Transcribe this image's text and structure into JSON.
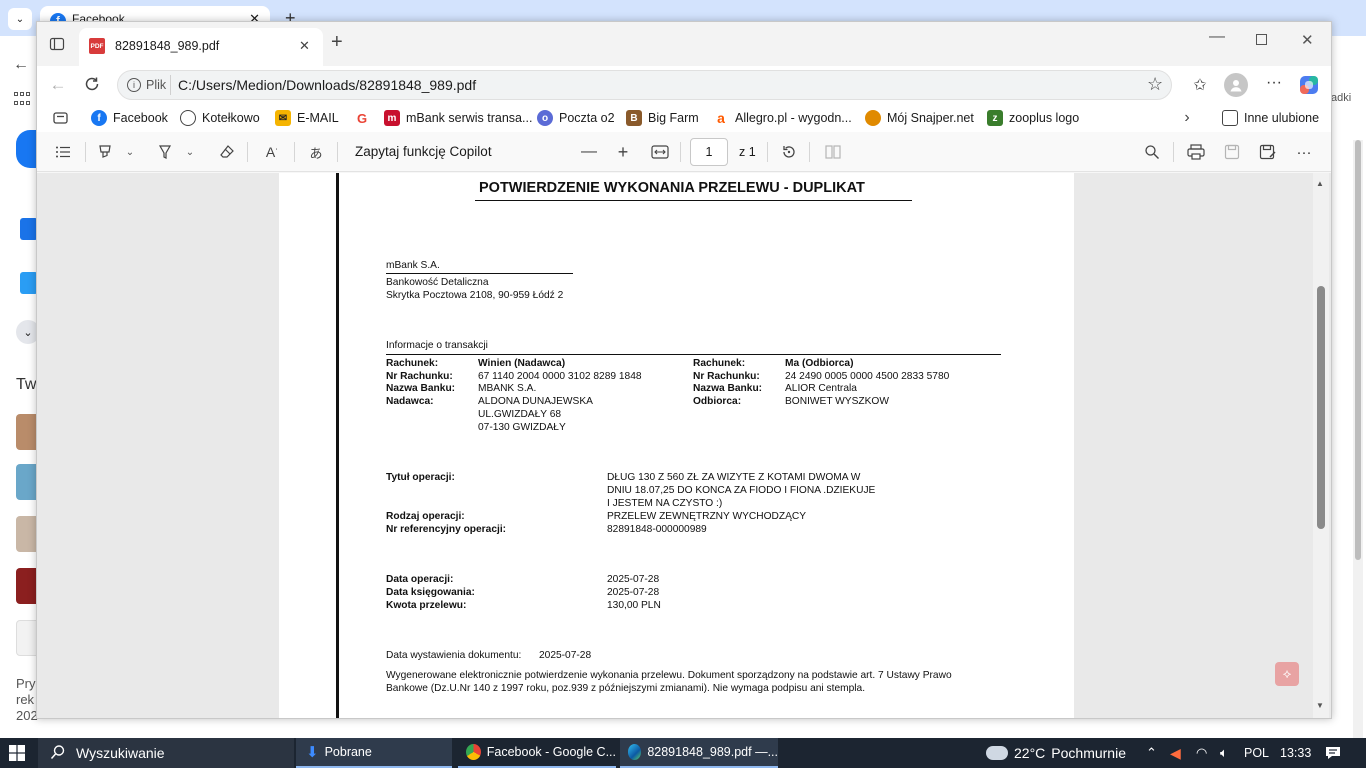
{
  "background_window": {
    "tab_title": "Facebook",
    "left_text_1": "Tw",
    "left_text_2": "Pry",
    "left_text_3": "rek",
    "left_text_4": "202",
    "right_text": "adki"
  },
  "edge": {
    "tab_title": "82891848_989.pdf",
    "address_label": "Plik",
    "address_url": "C:/Users/Medion/Downloads/82891848_989.pdf",
    "favorites": [
      {
        "label": "Facebook",
        "icon": "facebook-icon",
        "color": "#1877f2"
      },
      {
        "label": "Kotełkowo",
        "icon": "globe-icon",
        "color": "#444444"
      },
      {
        "label": "E-MAIL",
        "icon": "mail-icon",
        "color": "#f5b400"
      },
      {
        "label": "",
        "icon": "google-icon",
        "color": "#ea4335"
      },
      {
        "label": "mBank serwis transa...",
        "icon": "mbank-icon",
        "color": "#c8102e"
      },
      {
        "label": "Poczta o2",
        "icon": "o2-icon",
        "color": "#5b6bd6"
      },
      {
        "label": "Big Farm",
        "icon": "bigfarm-icon",
        "color": "#8a5a2b"
      },
      {
        "label": "Allegro.pl - wygodn...",
        "icon": "allegro-icon",
        "color": "#ff5a00"
      },
      {
        "label": "Mój Snajper.net",
        "icon": "snajper-icon",
        "color": "#e08a00"
      },
      {
        "label": "zooplus logo",
        "icon": "zooplus-icon",
        "color": "#3a7d2c"
      }
    ],
    "other_favorites": "Inne ulubione",
    "pdf_toolbar": {
      "copilot": "Zapytaj funkcję Copilot",
      "page_current": "1",
      "page_total": "z 1"
    }
  },
  "document": {
    "title": "POTWIERDZENIE WYKONANIA PRZELEWU - DUPLIKAT",
    "bank_name": "mBank S.A.",
    "bank_dept": "Bankowość Detaliczna",
    "bank_address": "Skrytka Pocztowa 2108, 90-959 Łódź 2",
    "section_info": "Informacje o transakcji",
    "left": {
      "rachunek_label": "Rachunek:",
      "rachunek_value": "Winien (Nadawca)",
      "nr_label": "Nr Rachunku:",
      "nr_value": "67 1140 2004 0000 3102 8289 1848",
      "bank_label": "Nazwa Banku:",
      "bank_value": "MBANK S.A.",
      "person_label": "Nadawca:",
      "person_line1": "ALDONA DUNAJEWSKA",
      "person_line2": "UL.GWIZDAŁY 68",
      "person_line3": "07-130 GWIZDAŁY"
    },
    "right": {
      "rachunek_label": "Rachunek:",
      "rachunek_value": "Ma (Odbiorca)",
      "nr_label": "Nr Rachunku:",
      "nr_value": "24 2490 0005 0000 4500 2833 5780",
      "bank_label": "Nazwa Banku:",
      "bank_value": "ALIOR Centrala",
      "person_label": "Odbiorca:",
      "person_value": "BONIWET WYSZKOW"
    },
    "title_label": "Tytuł operacji:",
    "title_line1": "DŁUG 130 Z 560 ZŁ ZA WIZYTE Z KOTAMI DWOMA W",
    "title_line2": "DNIU 18.07,25 DO KONCA ZA FIODO I FIONA .DZIEKUJE",
    "title_line3": "I JESTEM NA CZYSTO :)",
    "type_label": "Rodzaj operacji:",
    "type_value": "PRZELEW ZEWNĘTRZNY WYCHODZĄCY",
    "ref_label": "Nr referencyjny operacji:",
    "ref_value": "82891848-000000989",
    "date_op_label": "Data operacji:",
    "date_op_value": "2025-07-28",
    "date_book_label": "Data księgowania:",
    "date_book_value": "2025-07-28",
    "amount_label": "Kwota przelewu:",
    "amount_value": "130,00 PLN",
    "issue_label": "Data wystawienia dokumentu:",
    "issue_value": "2025-07-28",
    "footer_line1": "Wygenerowane elektronicznie potwierdzenie wykonania przelewu. Dokument sporządzony na podstawie art. 7 Ustawy Prawo",
    "footer_line2": "Bankowe (Dz.U.Nr 140 z 1997 roku, poz.939 z późniejszymi zmianami). Nie wymaga podpisu ani stempla."
  },
  "taskbar": {
    "search": "Wyszukiwanie",
    "tasks": [
      {
        "label": "Pobrane",
        "icon": "download-icon"
      },
      {
        "label": "Facebook - Google C...",
        "icon": "chrome-icon"
      },
      {
        "label": "82891848_989.pdf —...",
        "icon": "edge-icon"
      }
    ],
    "weather_temp": "22°C",
    "weather_text": "Pochmurnie",
    "language": "POL",
    "time": "13:33"
  }
}
